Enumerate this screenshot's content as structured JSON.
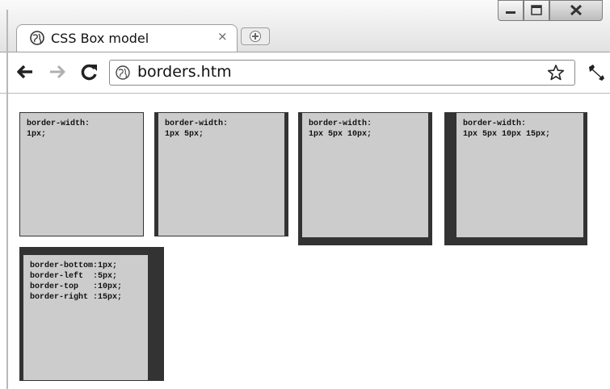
{
  "tab": {
    "title": "CSS Box model",
    "close_glyph": "×"
  },
  "toolbar": {
    "url": "borders.htm"
  },
  "icons": {
    "tab_favicon": "globe-icon",
    "new_tab": "new-tab-plus-icon",
    "back": "back-arrow-icon",
    "forward": "forward-arrow-icon",
    "reload": "reload-icon",
    "page_icon": "globe-icon",
    "bookmark": "star-icon",
    "settings": "wrench-icon"
  },
  "colors": {
    "box_fill": "#cccccc",
    "border": "#333333"
  },
  "boxes": [
    {
      "label": "border-width:\n1px;"
    },
    {
      "label": "border-width:\n1px 5px;"
    },
    {
      "label": "border-width:\n1px 5px 10px;"
    },
    {
      "label": "border-width:\n1px 5px 10px 15px;"
    },
    {
      "label": "border-bottom:1px;\nborder-left  :5px;\nborder-top   :10px;\nborder-right :15px;"
    }
  ]
}
